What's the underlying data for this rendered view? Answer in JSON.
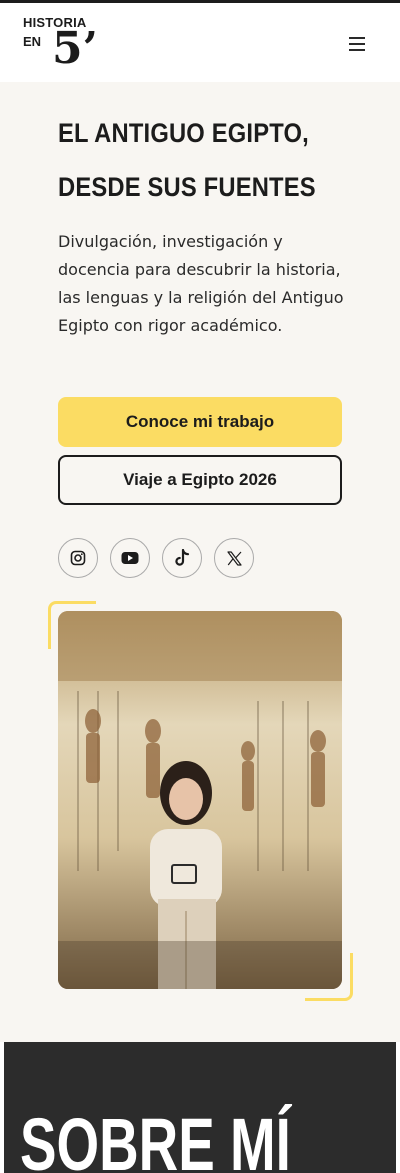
{
  "header": {
    "logo_line1": "HISTORIA",
    "logo_line2": "EN",
    "logo_mark": "5’",
    "menu_icon": "hamburger-menu-icon"
  },
  "hero": {
    "title_line1": "EL ANTIGUO EGIPTO,",
    "title_line2": "DESDE SUS FUENTES",
    "description": "Divulgación, investigación y docencia para descubrir la historia, las lenguas y la religión del Antiguo Egipto con rigor académico.",
    "primary_button": "Conoce mi trabajo",
    "secondary_button": "Viaje a Egipto 2026"
  },
  "socials": [
    {
      "name": "instagram-icon"
    },
    {
      "name": "youtube-icon"
    },
    {
      "name": "tiktok-icon"
    },
    {
      "name": "x-icon"
    }
  ],
  "about": {
    "title": "SOBRE MÍ"
  },
  "colors": {
    "accent": "#fbdc63",
    "background": "#f8f6f2",
    "dark": "#2c2c2c",
    "text": "#1c1c1c"
  }
}
